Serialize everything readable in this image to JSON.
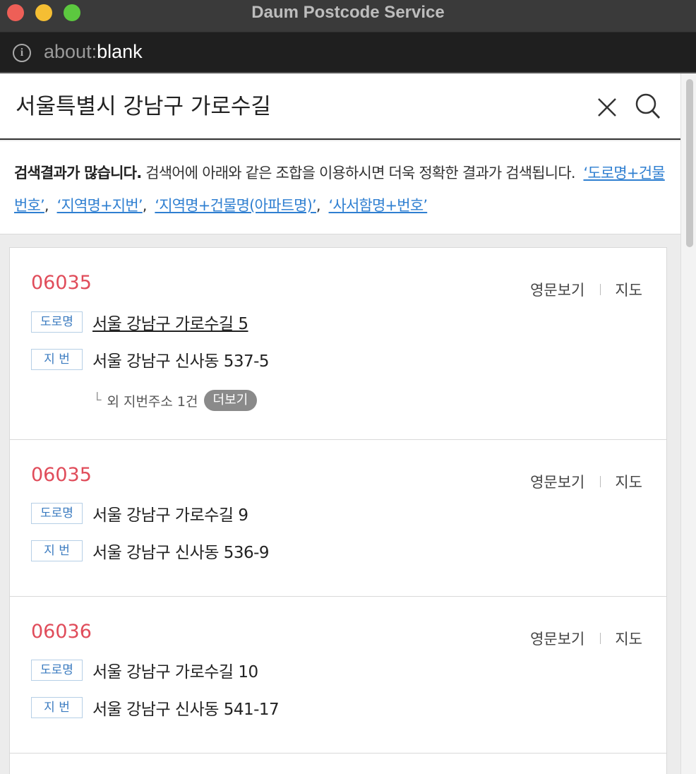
{
  "window": {
    "title": "Daum Postcode Service"
  },
  "urlbar": {
    "scheme": "about:",
    "host": "blank"
  },
  "search": {
    "value": "서울특별시 강남구 가로수길"
  },
  "notice": {
    "bold": "검색결과가 많습니다.",
    "text": " 검색어에 아래와 같은 조합을 이용하시면 더욱 정확한 결과가 검색됩니다.",
    "links": [
      "‘도로명+건물번호’",
      "‘지역명+지번’",
      "‘지역명+건물명(아파트명)’",
      "‘사서함명+번호’"
    ]
  },
  "labels": {
    "road": "도로명",
    "jibun": "지 번",
    "english": "영문보기",
    "map": "지도",
    "more": "더보기"
  },
  "results": [
    {
      "zip": "06035",
      "road": "서울 강남구 가로수길 5",
      "jibun": "서울 강남구 신사동 537-5",
      "extra": "외 지번주소 1건"
    },
    {
      "zip": "06035",
      "road": "서울 강남구 가로수길 9",
      "jibun": "서울 강남구 신사동 536-9"
    },
    {
      "zip": "06036",
      "road": "서울 강남구 가로수길 10",
      "jibun": "서울 강남구 신사동 541-17"
    }
  ]
}
